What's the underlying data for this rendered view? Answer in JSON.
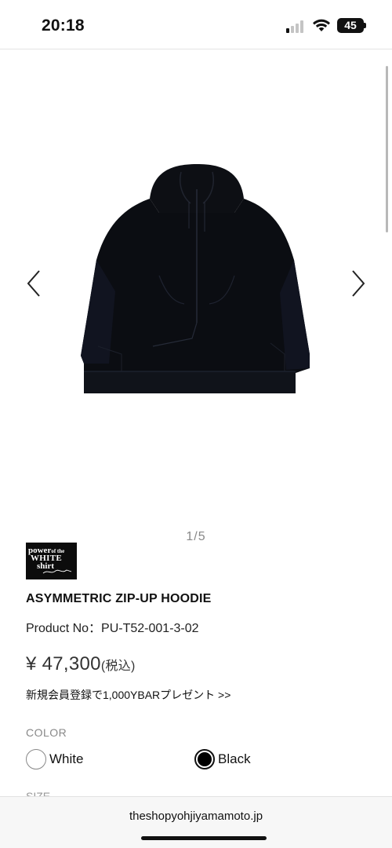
{
  "status_bar": {
    "time": "20:18",
    "battery_level": "45",
    "icons": [
      "signal-icon",
      "wifi-icon",
      "battery-icon"
    ]
  },
  "gallery": {
    "pager": "1/5",
    "image": "black-zip-up-hoodie",
    "controls": [
      "chevron-left-icon",
      "chevron-right-icon"
    ]
  },
  "product": {
    "brand_logo": {
      "line1": "power",
      "line1_small": "of the",
      "line2": "WHITE",
      "line3": "shirt"
    },
    "name": "ASYMMETRIC ZIP-UP HOODIE",
    "product_no": "Product No：PU-T52-001-3-02",
    "price": "¥ 47,300",
    "price_tax": "(税込)",
    "promo": "新規会員登録で1,000YBARプレゼント >>"
  },
  "color": {
    "label": "COLOR",
    "options": [
      {
        "label": "White",
        "swatch": "#ffffff",
        "selected": false
      },
      {
        "label": "Black",
        "swatch": "#000000",
        "selected": true
      }
    ]
  },
  "size": {
    "label": "SIZE"
  },
  "browser": {
    "url": "theshopyohjiyamamoto.jp"
  }
}
